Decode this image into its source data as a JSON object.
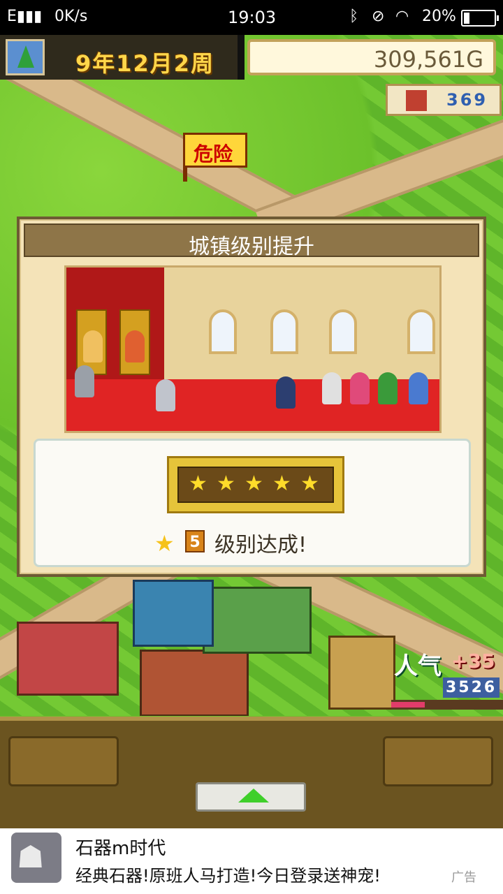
{
  "status_bar": {
    "signal": "E▮▮▮",
    "net_speed": "0K/s",
    "time": "19:03",
    "bluetooth_icon": "bluetooth-icon",
    "mute_icon": "mute-icon",
    "wifi_icon": "wifi-icon",
    "battery_percent": "20%",
    "battery_level": 0.2
  },
  "hud": {
    "date": "9年12月2周",
    "money": "309,561G",
    "house_count": "369",
    "danger_flag": "危险"
  },
  "dialog": {
    "title": "城镇级别提升",
    "stars": [
      "★",
      "★",
      "★",
      "★",
      "★"
    ],
    "level": "5",
    "achieve_text": "级别达成!"
  },
  "popularity": {
    "label": "人气",
    "delta": "+35",
    "value": "3526",
    "level": 0.3
  },
  "toolbar": {
    "up_icon": "chevron-up-icon"
  },
  "ad": {
    "title": "石器m时代",
    "description": "经典石器!原班人马打造!今日登录送神宠!",
    "tag": "广告"
  },
  "colors": {
    "accent_gold": "#ffd64a",
    "carpet_red": "#e02424",
    "grass_green": "#6cc12b"
  }
}
